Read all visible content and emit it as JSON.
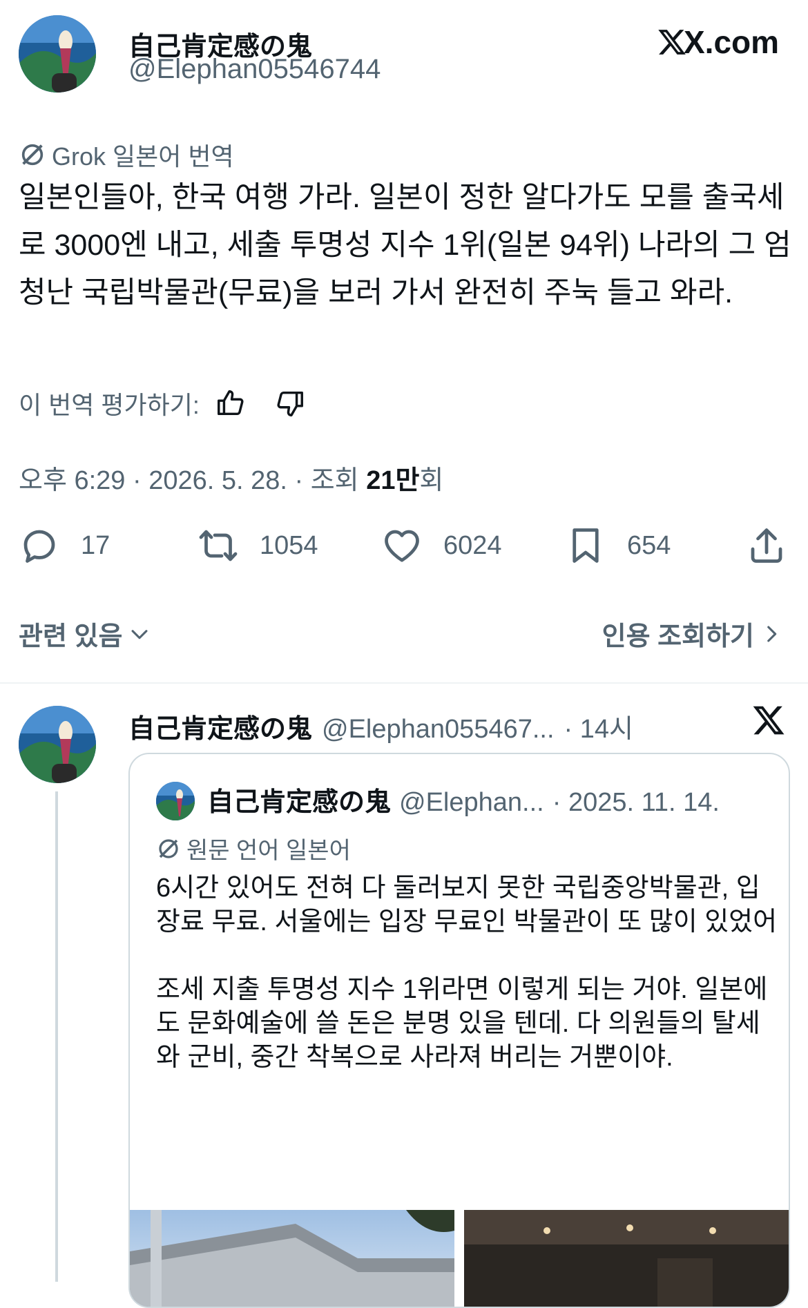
{
  "main_tweet": {
    "display_name": "自己肯定感の鬼",
    "handle": "@Elephan05546744",
    "site": "X.com",
    "translation_label": "Grok 일본어 번역",
    "text": "일본인들아, 한국 여행 가라. 일본이 정한 알다가도 모를 출국세로 3000엔 내고, 세출 투명성 지수 1위(일본 94위) 나라의 그 엄청난 국립박물관(무료)을 보러 가서 완전히 주눅 들고 와라.",
    "rate_label": "이 번역 평가하기:",
    "meta_prefix": "오후 6:29 · 2026. 5. 28. · 조회 ",
    "views_bold": "21만",
    "views_suffix": "회"
  },
  "actions": {
    "replies": "17",
    "retweets": "1054",
    "likes": "6024",
    "bookmarks": "654"
  },
  "footer": {
    "related": "관련 있음",
    "quotes": "인용 조회하기"
  },
  "reply_tweet": {
    "display_name": "自己肯定感の鬼",
    "handle": "@Elephan055467...",
    "time": "· 14시"
  },
  "quoted_tweet": {
    "display_name": "自己肯定感の鬼",
    "handle": "@Elephan...",
    "date": "· 2025. 11. 14.",
    "lang_label": "원문 언어 일본어",
    "text": "6시간 있어도 전혀 다 둘러보지 못한 국립중앙박물관, 입장료 무료. 서울에는 입장 무료인 박물관이 또 많이 있었어\n\n조세 지출 투명성 지수 1위라면 이렇게 되는 거야. 일본에도 문화예술에 쓸 돈은 분명 있을 텐데. 다 의원들의 탈세와 군비, 중간 착복으로 사라져 버리는 거뿐이야."
  },
  "icons": [
    "grok-icon",
    "thumbs-up-icon",
    "thumbs-down-icon",
    "reply-icon",
    "retweet-icon",
    "like-icon",
    "bookmark-icon",
    "share-icon",
    "chevron-down-icon",
    "chevron-right-icon",
    "x-logo-icon"
  ],
  "colors": {
    "text": "#0f1419",
    "muted": "#536471",
    "border": "#eff3f4"
  }
}
